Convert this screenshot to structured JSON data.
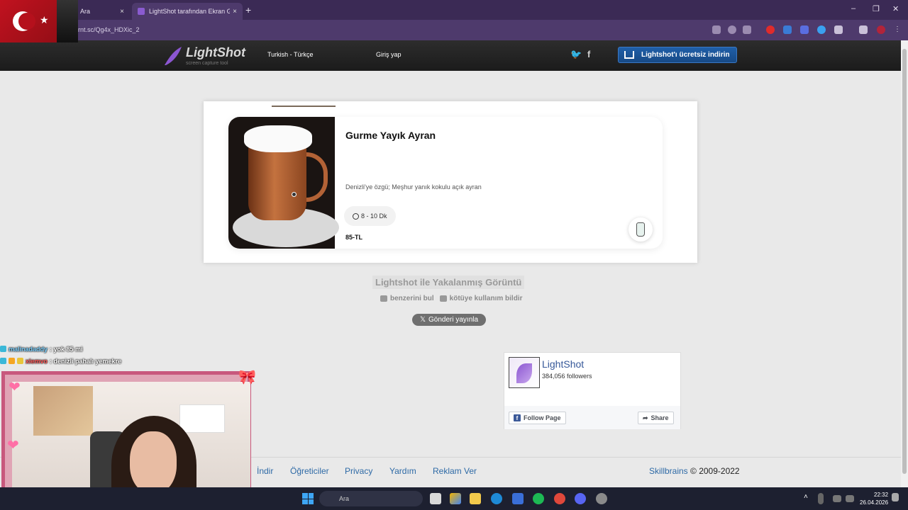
{
  "browser": {
    "tabs": [
      {
        "title": "Ara",
        "active": false
      },
      {
        "title": "LightShot tarafından Ekran Görü",
        "active": true
      }
    ],
    "new_tab": "+",
    "address": "rnt.sc/Qg4x_HDXic_2",
    "window_controls": {
      "minimize": "–",
      "restore": "❐",
      "close": "✕"
    },
    "close_glyph": "×"
  },
  "site_header": {
    "brand": "LightShot",
    "tagline": "screen capture tool",
    "language": "Turkish - Türkçe",
    "login": "Giriş yap",
    "twitter": "🐦",
    "facebook": "f",
    "download_button": "Lightshot'ı ücretsiz indirin"
  },
  "screenshot": {
    "item_title": "Gurme Yayık Ayran",
    "item_description": "Denizli'ye özgü; Meşhur yanık kokulu açık ayran",
    "prep_time": "8 - 10 Dk",
    "price": "85-TL"
  },
  "caption": {
    "title": "Lightshot ile Yakalanmış Görüntü",
    "find_similar": "benzerini bul",
    "report_abuse": "kötüye kullanım bildir",
    "post_button": "Gönderi yayınla",
    "x_glyph": "𝕏"
  },
  "facebook_widget": {
    "page_name": "LightShot",
    "followers": "384,056 followers",
    "follow_button": "Follow Page",
    "share_button": "Share",
    "fb_glyph": "f",
    "share_glyph": "➦"
  },
  "footer": {
    "links": [
      "İndir",
      "Öğreticiler",
      "Privacy",
      "Yardım",
      "Reklam Ver"
    ],
    "company": "Skillbrains",
    "years": " © 2009-2022"
  },
  "chat": [
    {
      "user": "malinadaddy",
      "message": ": yok 85 mi"
    },
    {
      "user": "xiemvo",
      "message": ": denizli pahalı yemekre"
    }
  ],
  "taskbar": {
    "search_placeholder": "Ara",
    "time": "22:32",
    "date": "26.04.2026"
  },
  "colors": {
    "header_dark": "#1b1b1b",
    "download_blue": "#1f5fa8",
    "link_blue": "#2e6aa6",
    "browser_purple": "#4e3a6c"
  }
}
